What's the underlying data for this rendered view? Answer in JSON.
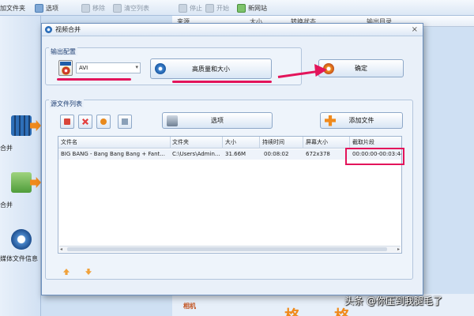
{
  "background": {
    "toolbar": [
      {
        "label": "加文件夹",
        "dim": false
      },
      {
        "label": "选项",
        "dim": false
      },
      {
        "label": "移除",
        "dim": true
      },
      {
        "label": "清空列表",
        "dim": true
      },
      {
        "label": "停止",
        "dim": true
      },
      {
        "label": "开始",
        "dim": true
      },
      {
        "label": "新网站",
        "dim": false
      }
    ],
    "columns": [
      "来源",
      "大小",
      "转换状态",
      "输出目录"
    ],
    "left_items": [
      "合并",
      "合并",
      "媒体文件信息"
    ],
    "banner": "相机"
  },
  "dialog": {
    "title": "视频合并",
    "output_group_label": "输出配置",
    "format_value": "AVI",
    "quality_button": "高质量和大小",
    "ok_button": "确定",
    "source_group_label": "源文件列表",
    "options_button": "选项",
    "add_file_button": "添加文件",
    "table": {
      "headers": [
        "文件名",
        "文件夹",
        "大小",
        "持续时间",
        "屏幕大小",
        "截取片段"
      ],
      "rows": [
        [
          "BIG BANG - Bang Bang Bang + Fant...",
          "C:\\Users\\Admin...",
          "31.66M",
          "00:08:02",
          "672x378",
          "00:00:00-00:03:44"
        ]
      ]
    }
  },
  "watermark": "头条 @你压到我腿毛了",
  "colors": {
    "annotation_red": "#e3145a",
    "accent_orange": "#f08a1c",
    "dialog_bg": "#e9f0f9"
  }
}
